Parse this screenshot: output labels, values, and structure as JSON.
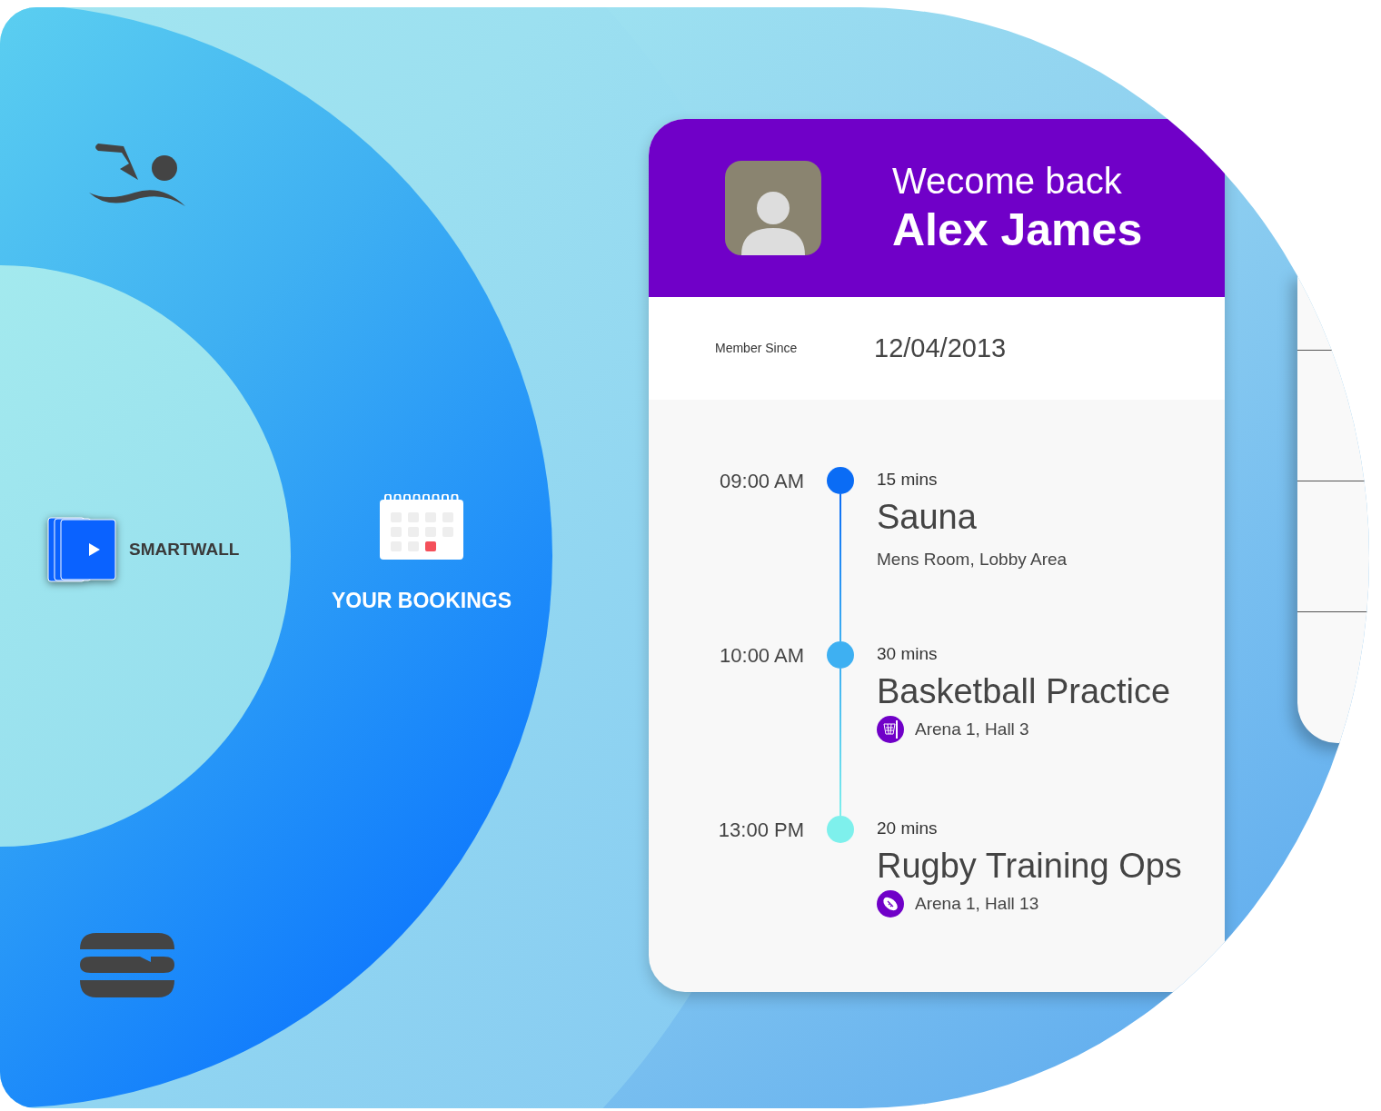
{
  "menu": [
    {
      "kind": "player",
      "label": "SMARTWALL"
    },
    {
      "kind": "calendar",
      "label": "YOUR BOOKINGS"
    }
  ],
  "profile": {
    "greeting": "Wecome back",
    "name": "Alex James",
    "member_since_label": "Member Since",
    "member_since": "12/04/2013"
  },
  "bookings": [
    {
      "time": "09:00 AM",
      "duration": "15 mins",
      "title": "Sauna",
      "location": "Mens Room, Lobby Area",
      "kind": "plain",
      "color": "#0a6cf5"
    },
    {
      "time": "10:00 AM",
      "duration": "30 mins",
      "title": "Basketball Practice",
      "location": "Arena 1, Hall 3",
      "kind": "basketball",
      "color": "#3eb0f2"
    },
    {
      "time": "13:00 PM",
      "duration": "20 mins",
      "title": "Rugby Training Ops",
      "location": "Arena 1, Hall 13",
      "kind": "rugby",
      "color": "#7ef0ec"
    }
  ]
}
